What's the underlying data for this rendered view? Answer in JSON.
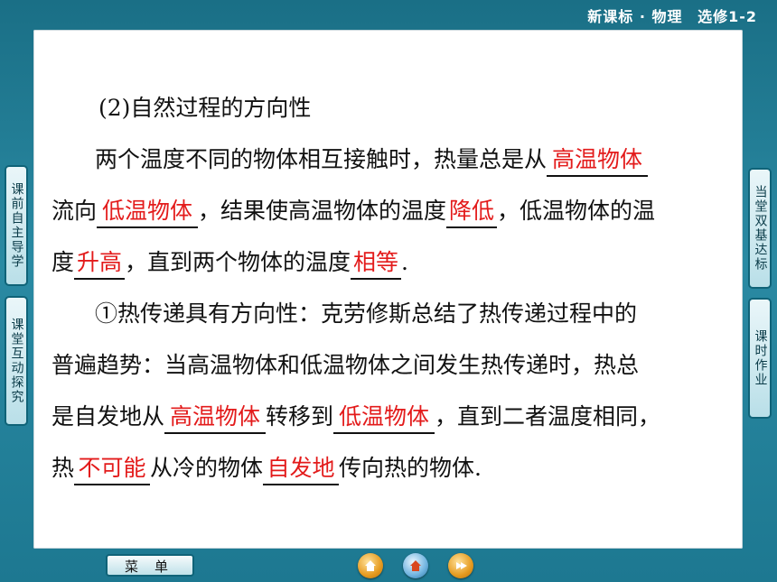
{
  "header": {
    "course": "新课标 · 物理",
    "edition": "选修1-2"
  },
  "left_nav": [
    {
      "label": "课前自主导学"
    },
    {
      "label": "课堂互动探究"
    }
  ],
  "right_nav": [
    {
      "label": "当堂双基达标"
    },
    {
      "label": "课时作业"
    }
  ],
  "content": {
    "heading": "(2)自然过程的方向性",
    "line1_a": "两个温度不同的物体相互接触时，热量总是从",
    "blank_hot": "高温物体",
    "line2_a": "流向",
    "blank_cold": "低温物体",
    "line2_b": "，结果使高温物体的温度",
    "blank_lower": "降低",
    "line2_c": "，低温物体的温",
    "line3_a": "度",
    "blank_rise": "升高",
    "line3_b": "，直到两个物体的温度",
    "blank_equal": "相等",
    "line3_c": ".",
    "line4": "①热传递具有方向性：克劳修斯总结了热传递过程中的",
    "line5": "普遍趋势：当高温物体和低温物体之间发生热传递时，热总",
    "line6_a": "是自发地从",
    "blank_hot2": "高温物体",
    "line6_b": "转移到",
    "blank_cold2": "低温物体",
    "line6_c": "，直到二者温度相同，",
    "line7_a": "热",
    "blank_impossible": "不可能",
    "line7_b": "从冷的物体",
    "blank_spontaneous": "自发地",
    "line7_c": "传向热的物体."
  },
  "bottom": {
    "menu_label": "菜单"
  },
  "colors": {
    "accent": "#1a6f86",
    "answer": "#e31b1b"
  },
  "icons": [
    "home-icon",
    "house-icon",
    "forward-icon"
  ]
}
